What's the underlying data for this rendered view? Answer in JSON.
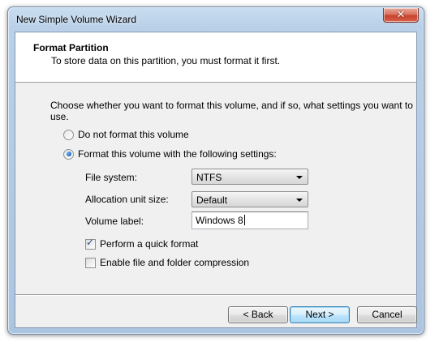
{
  "window": {
    "title": "New Simple Volume Wizard",
    "close_glyph": "✕"
  },
  "header": {
    "title": "Format Partition",
    "subtitle": "To store data on this partition, you must format it first."
  },
  "main": {
    "instruction": "Choose whether you want to format this volume, and if so, what settings you want to use.",
    "options": [
      {
        "label": "Do not format this volume",
        "checked": false
      },
      {
        "label": "Format this volume with the following settings:",
        "checked": true
      }
    ],
    "settings": {
      "file_system": {
        "label": "File system:",
        "value": "NTFS"
      },
      "allocation_unit": {
        "label": "Allocation unit size:",
        "value": "Default"
      },
      "volume_label": {
        "label": "Volume label:",
        "value": "Windows 8"
      }
    },
    "checkboxes": [
      {
        "label": "Perform a quick format",
        "checked": true
      },
      {
        "label": "Enable file and folder compression",
        "checked": false
      }
    ]
  },
  "footer": {
    "back_label": "< Back",
    "next_label": "Next >",
    "cancel_label": "Cancel"
  },
  "icons": {
    "check_glyph": "✓"
  }
}
